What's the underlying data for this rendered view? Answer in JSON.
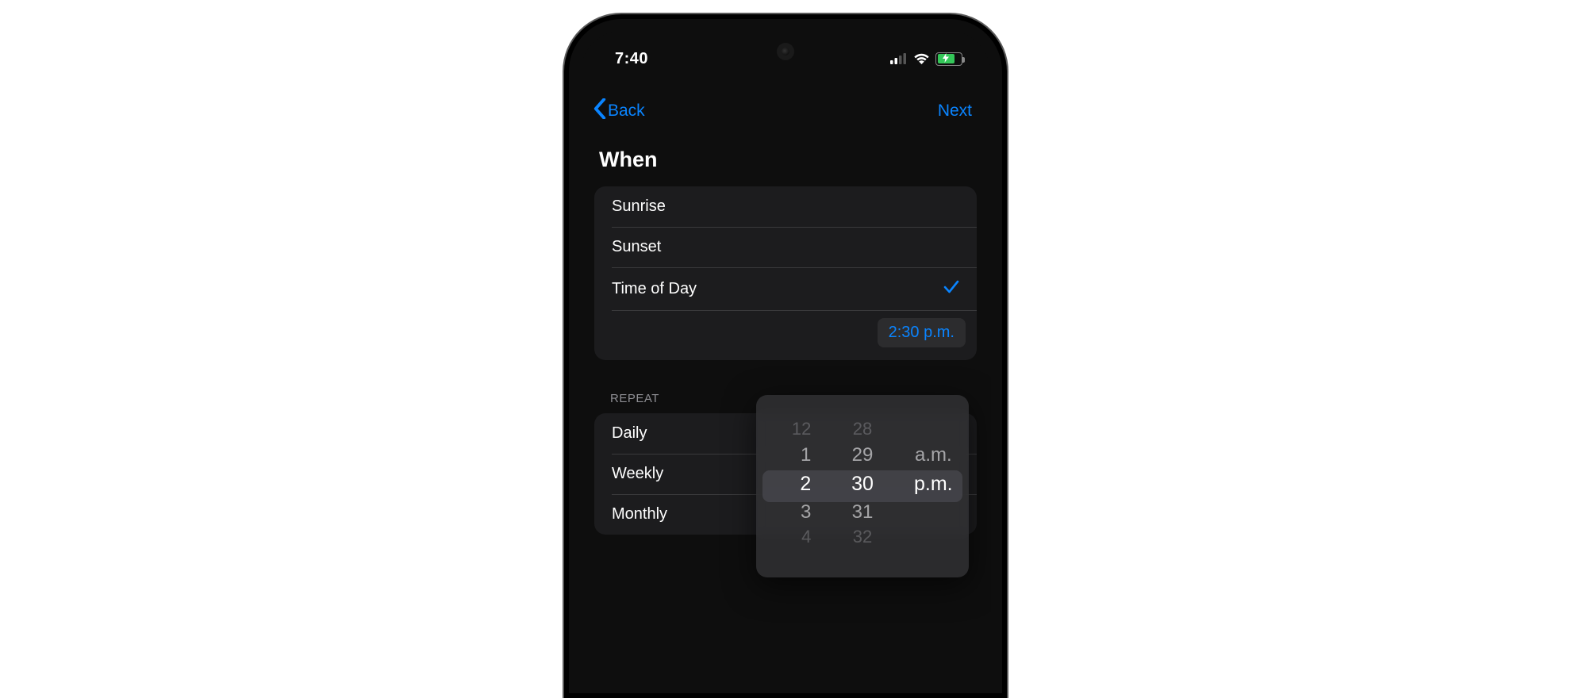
{
  "status": {
    "time": "7:40"
  },
  "nav": {
    "back_label": "Back",
    "next_label": "Next"
  },
  "title": "When",
  "when_options": [
    {
      "label": "Sunrise",
      "selected": false
    },
    {
      "label": "Sunset",
      "selected": false
    },
    {
      "label": "Time of Day",
      "selected": true
    }
  ],
  "selected_time": "2:30 p.m.",
  "repeat_header": "REPEAT",
  "repeat_options": [
    {
      "label": "Daily"
    },
    {
      "label": "Weekly"
    },
    {
      "label": "Monthly"
    }
  ],
  "picker": {
    "hours": [
      "12",
      "1",
      "2",
      "3",
      "4"
    ],
    "minutes": [
      "28",
      "29",
      "30",
      "31",
      "32"
    ],
    "periods": [
      "a.m.",
      "p.m."
    ],
    "selected_hour": "2",
    "selected_minute": "30",
    "selected_period": "p.m."
  },
  "colors": {
    "accent": "#0a84ff",
    "battery_fill": "#34c759"
  }
}
